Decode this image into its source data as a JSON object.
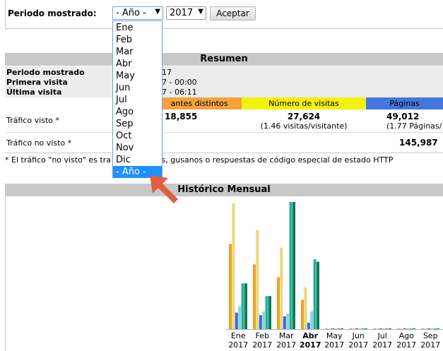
{
  "period": {
    "label": "Periodo mostrado:",
    "month_selected": "- Año -",
    "year_selected": "2017",
    "accept_label": "Aceptar"
  },
  "dropdown": {
    "options": [
      "Ene",
      "Feb",
      "Mar",
      "Abr",
      "May",
      "Jun",
      "Jul",
      "Ago",
      "Sep",
      "Oct",
      "Nov",
      "Dic",
      "- Año -"
    ],
    "highlighted": "- Año -"
  },
  "summary": {
    "title": "Resumen",
    "period_label": "Periodo mostrado",
    "period_value": "17",
    "first_visit_label": "Primera visita",
    "first_visit_value": "7 - 00:00",
    "last_visit_label": "Última visita",
    "last_visit_value": "7 - 06:11",
    "col_visitors": "antes distintos",
    "col_visits": "Número de visitas",
    "col_pages": "Páginas",
    "seen_label": "Tráfico visto *",
    "unseen_label": "Tráfico no visto *",
    "seen_visitors": "18,855",
    "seen_visits": "27,624",
    "seen_visits_sub": "(1.46 visitas/visitante)",
    "seen_pages": "49,012",
    "seen_pages_sub": "(1.77 Páginas/",
    "unseen_pages": "145,987",
    "footnote": "* El tráfico \"no visto\" es tra                  do por robots, gusanos o respuestas de código especial de estado HTTP"
  },
  "history": {
    "title": "Histórico Mensual",
    "months": [
      {
        "name": "Ene",
        "year": "2017",
        "bold": false
      },
      {
        "name": "Feb",
        "year": "2017",
        "bold": false
      },
      {
        "name": "Mar",
        "year": "2017",
        "bold": false
      },
      {
        "name": "Abr",
        "year": "2017",
        "bold": true
      },
      {
        "name": "May",
        "year": "2017",
        "bold": false
      },
      {
        "name": "Jun",
        "year": "2017",
        "bold": false
      },
      {
        "name": "Jul",
        "year": "2017",
        "bold": false
      },
      {
        "name": "Ago",
        "year": "2017",
        "bold": false
      },
      {
        "name": "Sep",
        "year": "2017",
        "bold": false
      }
    ]
  },
  "chart_data": {
    "type": "bar",
    "categories": [
      "Ene",
      "Feb",
      "Mar",
      "Abr",
      "May",
      "Jun",
      "Jul",
      "Ago",
      "Sep"
    ],
    "series": [
      {
        "values": [
          0.67,
          0.51,
          0.41,
          0.23,
          0,
          0,
          0,
          0,
          0
        ]
      },
      {
        "values": [
          0.99,
          0.78,
          0.64,
          0.33,
          0,
          0,
          0,
          0,
          0
        ]
      },
      {
        "values": [
          0.13,
          0.11,
          0.1,
          0.05,
          0,
          0,
          0,
          0,
          0
        ]
      },
      {
        "values": [
          0.18,
          0.14,
          0.12,
          0.14,
          0,
          0,
          0,
          0,
          0
        ]
      },
      {
        "values": [
          0.36,
          0.26,
          1.0,
          0.55,
          0,
          0,
          0,
          0,
          0
        ]
      },
      {
        "values": [
          0.36,
          0.26,
          1.0,
          0.53,
          0,
          0,
          0,
          0,
          0
        ]
      }
    ],
    "colors": [
      "#f0a028",
      "#e8d878",
      "#3a6bd6",
      "#88d8d8",
      "#20b0a0",
      "#187858"
    ],
    "ylim": [
      0,
      1
    ]
  },
  "colors": {
    "header_gray": "#c8c8c8",
    "visitors": "#f5a23f",
    "visits": "#f2f20a",
    "pages": "#4477dd",
    "pointer": "#e06040"
  }
}
